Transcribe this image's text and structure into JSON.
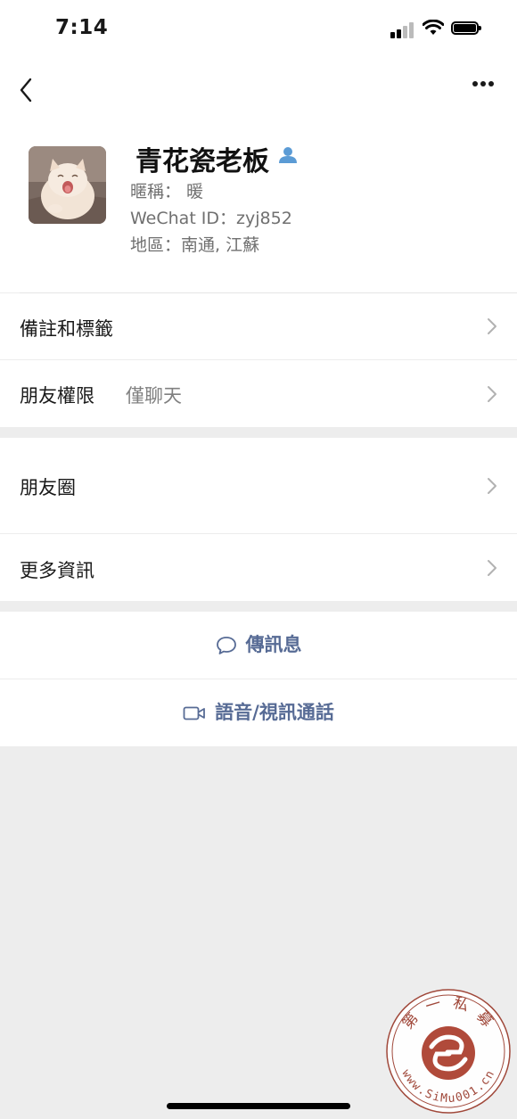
{
  "status_bar": {
    "time": "7:14"
  },
  "profile": {
    "name": "青花瓷老板",
    "nickname": "暱稱： 暖",
    "wechat_id": "WeChat ID：zyj852",
    "region": "地區：南通, 江蘇"
  },
  "section1": {
    "items": [
      {
        "label": "備註和標籤"
      },
      {
        "label": "朋友權限",
        "value": "僅聊天"
      }
    ]
  },
  "section2": {
    "items": [
      {
        "label": "朋友圈"
      },
      {
        "label": "更多資訊"
      }
    ]
  },
  "actions": {
    "message": "傳訊息",
    "call": "語音/視訊通話"
  },
  "watermark": {
    "text_top": "第 一 私 募",
    "text_bottom": "www.SiMu001.cn"
  },
  "colors": {
    "link": "#576b95",
    "background": "#ededed",
    "watermark": "#a0483a"
  },
  "icons": [
    "back-icon",
    "more-icon",
    "person-icon",
    "chevron-right-icon",
    "chat-bubble-icon",
    "video-camera-icon"
  ]
}
